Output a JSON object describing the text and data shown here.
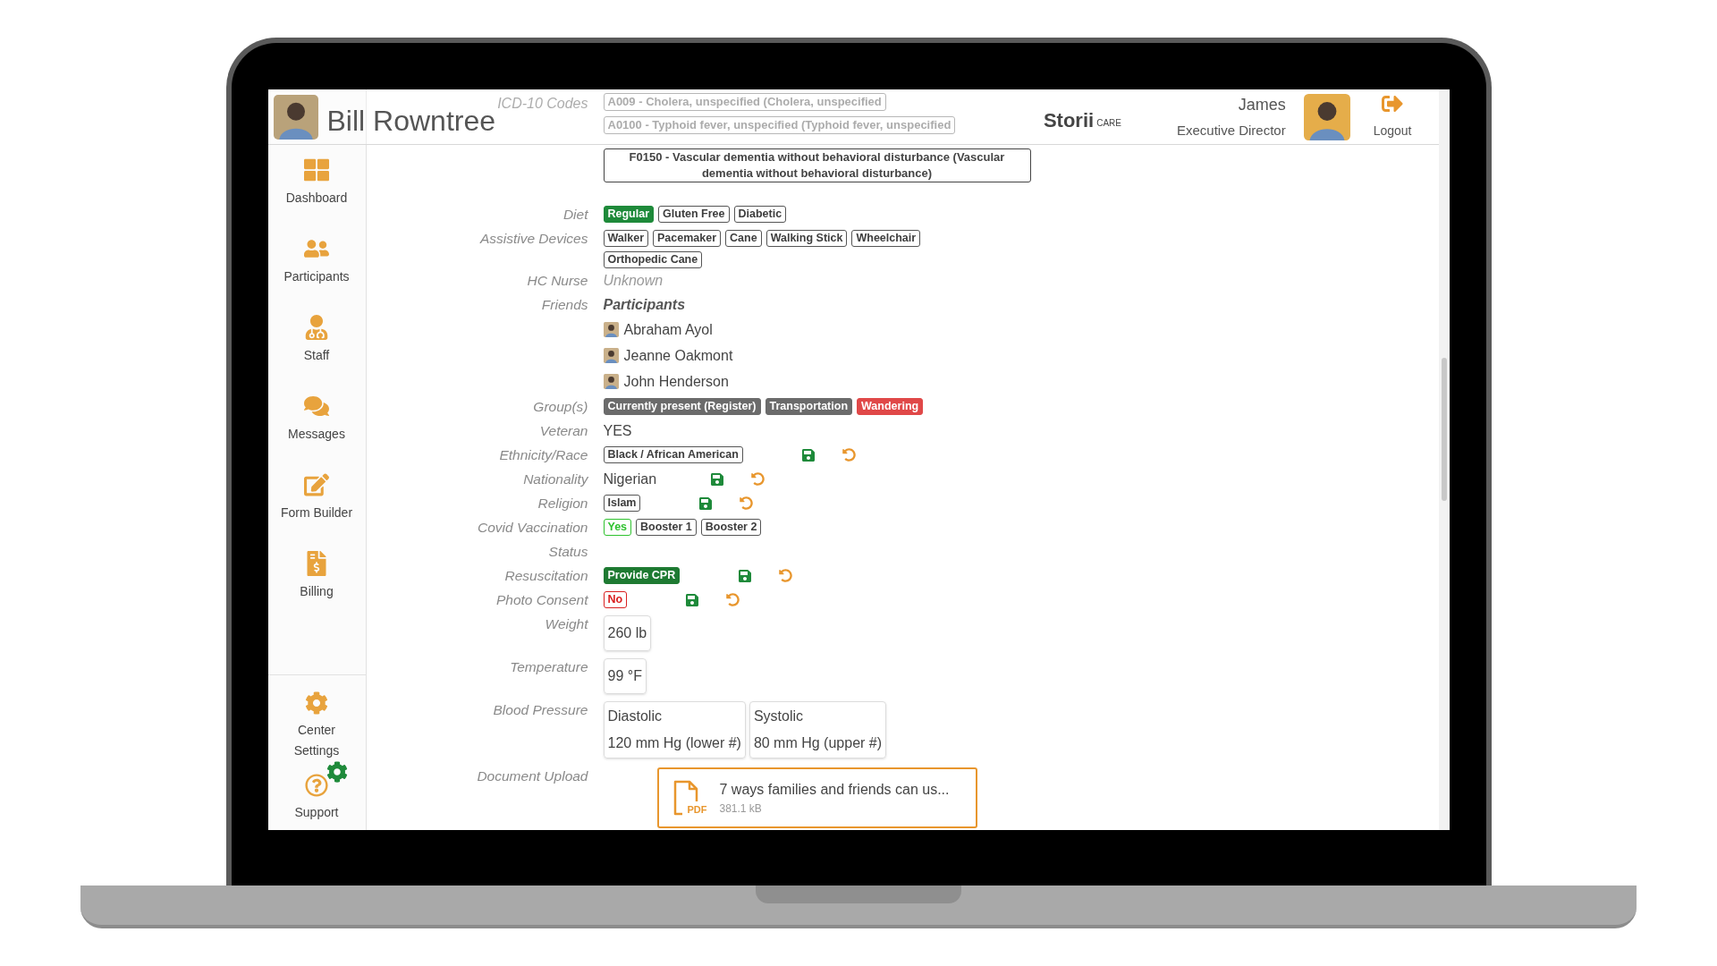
{
  "header": {
    "patient_name": "Bill Rowntree",
    "logo": {
      "name": "Storii",
      "suffix": "CARE"
    },
    "user": {
      "name": "James",
      "role": "Executive Director"
    },
    "logout": "Logout"
  },
  "sidebar": {
    "items": [
      {
        "label": "Dashboard"
      },
      {
        "label": "Participants"
      },
      {
        "label": "Staff"
      },
      {
        "label": "Messages"
      },
      {
        "label": "Form Builder"
      },
      {
        "label": "Billing"
      }
    ],
    "footer_items": [
      {
        "label": "Center Settings"
      },
      {
        "label": "Support"
      }
    ]
  },
  "icd": {
    "label": "ICD-10 Codes",
    "codes": [
      "A009 - Cholera, unspecified (Cholera, unspecified",
      "A0100 - Typhoid fever, unspecified (Typhoid fever, unspecified",
      "F0150 - Vascular dementia without behavioral disturbance (Vascular dementia without behavioral disturbance)"
    ]
  },
  "fields": [
    {
      "label": "Diet",
      "kind": "tags",
      "editing": false,
      "tags": [
        {
          "text": "Regular",
          "kind": "solid",
          "color": "#1e8a3a"
        },
        {
          "text": "Gluten Free",
          "kind": "outline",
          "color": "#555555"
        },
        {
          "text": "Diabetic",
          "kind": "outline",
          "color": "#555555"
        }
      ]
    },
    {
      "label": "Assistive Devices",
      "kind": "tags",
      "editing": false,
      "tags": [
        {
          "text": "Walker",
          "kind": "outline",
          "color": "#555555"
        },
        {
          "text": "Pacemaker",
          "kind": "outline",
          "color": "#555555"
        },
        {
          "text": "Cane",
          "kind": "outline",
          "color": "#555555"
        },
        {
          "text": "Walking Stick",
          "kind": "outline",
          "color": "#555555"
        },
        {
          "text": "Wheelchair",
          "kind": "outline",
          "color": "#555555"
        },
        {
          "text": "Orthopedic Cane",
          "kind": "outline",
          "color": "#555555"
        }
      ]
    },
    {
      "label": "HC Nurse",
      "kind": "empty",
      "editing": false,
      "value": "Unknown"
    },
    {
      "label": "Friends",
      "kind": "friends",
      "editing": false,
      "heading": "Participants",
      "people": [
        "Abraham Ayol",
        "Jeanne Oakmont",
        "John Henderson"
      ]
    },
    {
      "label": "Group(s)",
      "kind": "tags",
      "editing": false,
      "tags": [
        {
          "text": "Currently present (Register)",
          "kind": "solid",
          "color": "#6b6b6b"
        },
        {
          "text": "Transportation",
          "kind": "solid",
          "color": "#6b6b6b"
        },
        {
          "text": "Wandering",
          "kind": "solid",
          "color": "#e04848"
        }
      ]
    },
    {
      "label": "Veteran",
      "kind": "text",
      "editing": false,
      "value": "YES"
    },
    {
      "label": "Ethnicity/Race",
      "kind": "tags",
      "editing": true,
      "tags": [
        {
          "text": "Black / African American",
          "kind": "outline",
          "color": "#555555"
        }
      ]
    },
    {
      "label": "Nationality",
      "kind": "text",
      "editing": true,
      "value": "Nigerian"
    },
    {
      "label": "Religion",
      "kind": "tags",
      "editing": true,
      "tags": [
        {
          "text": "Islam",
          "kind": "outline",
          "color": "#555555"
        }
      ]
    },
    {
      "label": "Covid Vaccination Status",
      "kind": "tags",
      "editing": false,
      "tags": [
        {
          "text": "Yes",
          "kind": "outline",
          "color": "#2fc22f"
        },
        {
          "text": "Booster 1",
          "kind": "outline",
          "color": "#555555"
        },
        {
          "text": "Booster 2",
          "kind": "outline",
          "color": "#555555"
        }
      ]
    },
    {
      "label": "Resuscitation",
      "kind": "tags",
      "editing": true,
      "tags": [
        {
          "text": "Provide CPR",
          "kind": "solid",
          "color": "#1e7a32"
        }
      ]
    },
    {
      "label": "Photo Consent",
      "kind": "tags",
      "editing": true,
      "tags": [
        {
          "text": "No",
          "kind": "outline",
          "color": "#d92020"
        }
      ]
    },
    {
      "label": "Weight",
      "kind": "box",
      "editing": false,
      "value": "260 lb"
    },
    {
      "label": "Temperature",
      "kind": "box",
      "editing": false,
      "value": "99 °F"
    },
    {
      "label": "Blood Pressure",
      "kind": "pair",
      "editing": false,
      "boxes": [
        {
          "label": "Diastolic",
          "value": "120 mm Hg (lower #)"
        },
        {
          "label": "Systolic",
          "value": "80 mm Hg (upper #)"
        }
      ]
    },
    {
      "label": "Document Upload",
      "kind": "document",
      "editing": false,
      "file": {
        "icon_label": "PDF",
        "title": "7 ways families and friends can us...",
        "size": "381.1 kB"
      }
    }
  ]
}
